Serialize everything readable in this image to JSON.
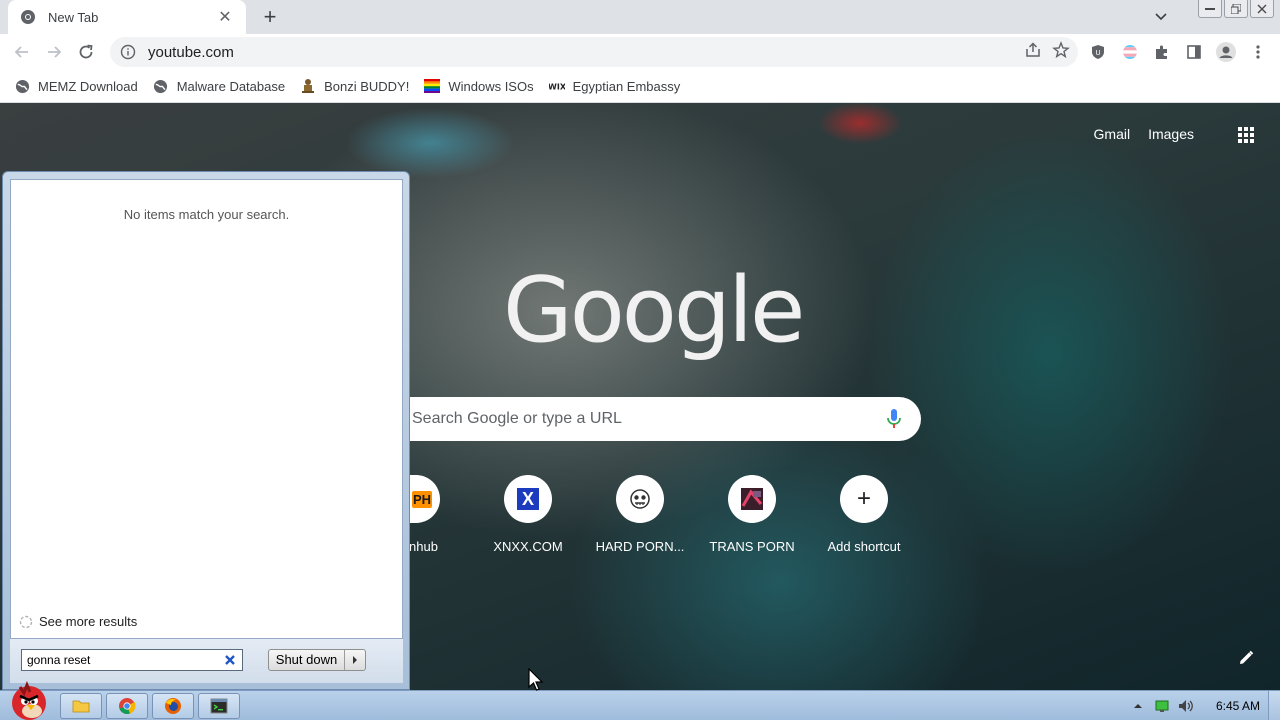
{
  "browser": {
    "tab": {
      "title": "New Tab"
    },
    "address": {
      "url": "youtube.com"
    },
    "bookmarks": [
      {
        "label": "MEMZ Download",
        "icon": "globe-icon"
      },
      {
        "label": "Malware Database",
        "icon": "globe-icon"
      },
      {
        "label": "Bonzi BUDDY!",
        "icon": "bonzi-icon"
      },
      {
        "label": "Windows ISOs",
        "icon": "rainbow-flag-icon"
      },
      {
        "label": "Egyptian Embassy",
        "icon": "wix-icon"
      }
    ]
  },
  "ntp": {
    "links": {
      "gmail": "Gmail",
      "images": "Images"
    },
    "logo": "Google",
    "search": {
      "placeholder": "Search Google or type a URL"
    },
    "shortcuts": [
      {
        "label": "nhub",
        "badge": "PH"
      },
      {
        "label": "XNXX.COM",
        "badge": "X"
      },
      {
        "label": "HARD PORN...",
        "badge": ""
      },
      {
        "label": "TRANS PORN",
        "badge": ""
      },
      {
        "label": "Add shortcut",
        "badge": "+"
      }
    ]
  },
  "start_menu": {
    "empty_message": "No items match your search.",
    "see_more": "See more results",
    "search_value": "gonna reset",
    "shutdown_label": "Shut down"
  },
  "taskbar": {
    "clock": "6:45 AM"
  },
  "colors": {
    "chrome_bg": "#dee1e6",
    "taskbar": "#b9d1ea",
    "clear_x": "#1f57c9"
  }
}
